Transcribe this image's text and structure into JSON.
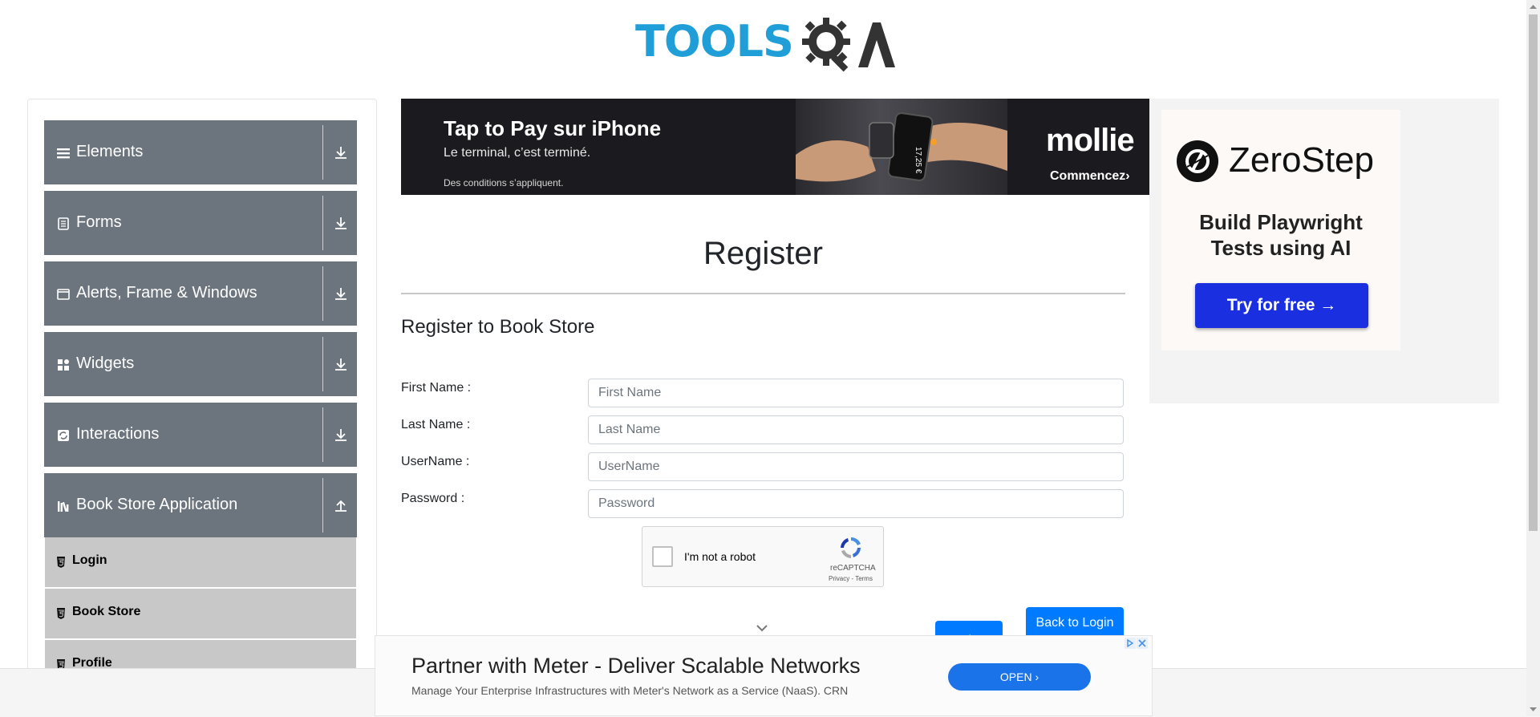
{
  "logo": {
    "word": "TOOLS",
    "rest": "QA"
  },
  "sidebar": {
    "groups": [
      {
        "label": "Elements",
        "icon": "hamburger-icon"
      },
      {
        "label": "Forms",
        "icon": "document-icon"
      },
      {
        "label": "Alerts, Frame & Windows",
        "icon": "window-icon"
      },
      {
        "label": "Widgets",
        "icon": "grid-icon"
      },
      {
        "label": "Interactions",
        "icon": "refresh-icon"
      },
      {
        "label": "Book Store Application",
        "icon": "books-icon"
      }
    ],
    "subitems": [
      {
        "label": "Login"
      },
      {
        "label": "Book Store"
      },
      {
        "label": "Profile"
      }
    ]
  },
  "ads": {
    "top": {
      "headline": "Tap to Pay sur iPhone",
      "subline": "Le terminal, c’est terminé.",
      "note": "Des conditions s’appliquent.",
      "brand": "mollie",
      "cta": "Commencez›",
      "price_on_phone": "17,25 €"
    },
    "right": {
      "brand": "ZeroStep",
      "headline_line1": "Build Playwright",
      "headline_line2": "Tests using AI",
      "cta": "Try for free →"
    },
    "bottom": {
      "headline": "Partner with Meter - Deliver Scalable Networks",
      "description": "Manage Your Enterprise Infrastructures with Meter's Network as a Service (NaaS). CRN",
      "cta": "OPEN"
    }
  },
  "form": {
    "title": "Register",
    "heading": "Register to Book Store",
    "fields": [
      {
        "label": "First Name :",
        "placeholder": "First Name"
      },
      {
        "label": "Last Name :",
        "placeholder": "Last Name"
      },
      {
        "label": "UserName :",
        "placeholder": "UserName"
      },
      {
        "label": "Password :",
        "placeholder": "Password"
      }
    ],
    "captcha": {
      "label": "I'm not a robot",
      "brand": "reCAPTCHA",
      "links": "Privacy - Terms"
    },
    "register_button": "Register",
    "back_button": "Back to Login"
  },
  "colors": {
    "sidebar_group": "#6c757d",
    "sidebar_sub": "#c8c8c8",
    "primary": "#007bff",
    "logo_blue": "#1f9ed8"
  }
}
